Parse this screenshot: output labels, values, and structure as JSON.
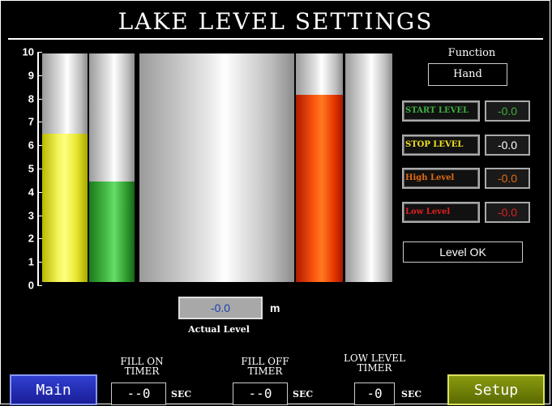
{
  "title": "LAKE LEVEL SETTINGS",
  "y_axis": {
    "ticks": [
      "10",
      "9",
      "8",
      "7",
      "6",
      "5",
      "4",
      "3",
      "2",
      "1",
      "0"
    ]
  },
  "bars": [
    {
      "name": "yellow",
      "level": 6.5
    },
    {
      "name": "green",
      "level": 4.4
    },
    {
      "name": "lake",
      "level": 0
    },
    {
      "name": "red",
      "level": 8.2
    },
    {
      "name": "empty",
      "level": 0
    }
  ],
  "function": {
    "label": "Function",
    "value": "Hand"
  },
  "levels": [
    {
      "label": "START LEVEL",
      "value": "-0.0",
      "color": "#3fae3f",
      "value_color": "#3fae3f"
    },
    {
      "label": "STOP LEVEL",
      "value": "-0.0",
      "color": "#f0e020",
      "value_color": "#ffffff"
    },
    {
      "label": "High Level",
      "value": "-0.0",
      "color": "#e06a10",
      "value_color": "#e06a10"
    },
    {
      "label": "Low Level",
      "value": "-0.0",
      "color": "#e02020",
      "value_color": "#e02020"
    }
  ],
  "status": "Level OK",
  "actual": {
    "value": "-0.0",
    "unit": "m",
    "label": "Actual Level"
  },
  "timers": [
    {
      "label_line1": "FILL ON",
      "label_line2": "TIMER",
      "value": "--0",
      "unit": "SEC"
    },
    {
      "label_line1": "FILL OFF",
      "label_line2": "TIMER",
      "value": "--0",
      "unit": "SEC"
    },
    {
      "label_line1": "LOW LEVEL",
      "label_line2": "TIMER",
      "value": "-0",
      "unit": "SEC"
    }
  ],
  "nav": {
    "main": "Main",
    "setup": "Setup"
  }
}
